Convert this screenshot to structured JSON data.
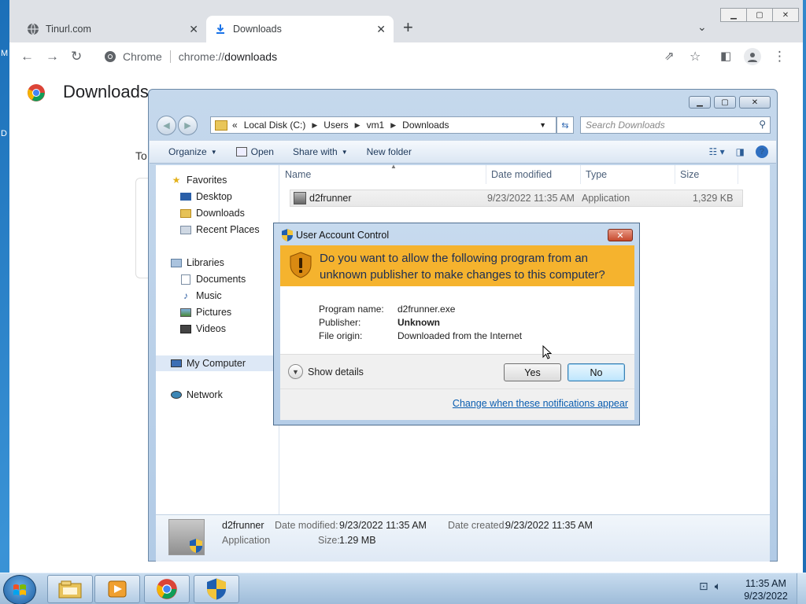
{
  "desktop": {
    "frag1": "M",
    "frag2": "D"
  },
  "chrome": {
    "tabs": [
      {
        "title": "Tinurl.com",
        "icon": "globe-icon"
      },
      {
        "title": "Downloads",
        "icon": "download-icon"
      }
    ],
    "omnibox": {
      "chip": "Chrome",
      "url_scheme": "chrome://",
      "url_path": "downloads"
    },
    "page": {
      "title": "Downloads",
      "frag": "To"
    }
  },
  "explorer": {
    "breadcrumb": [
      "Local Disk (C:)",
      "Users",
      "vm1",
      "Downloads"
    ],
    "search_placeholder": "Search Downloads",
    "commands": {
      "organize": "Organize",
      "open": "Open",
      "share_with": "Share with",
      "new_folder": "New folder"
    },
    "nav": {
      "favorites": "Favorites",
      "favorites_items": [
        "Desktop",
        "Downloads",
        "Recent Places"
      ],
      "libraries": "Libraries",
      "libraries_items": [
        "Documents",
        "Music",
        "Pictures",
        "Videos"
      ],
      "my_computer": "My Computer",
      "network": "Network"
    },
    "columns": [
      "Name",
      "Date modified",
      "Type",
      "Size"
    ],
    "files": [
      {
        "name": "d2frunner",
        "date": "9/23/2022 11:35 AM",
        "type": "Application",
        "size": "1,329 KB"
      }
    ],
    "details": {
      "name": "d2frunner",
      "type": "Application",
      "date_modified_label": "Date modified:",
      "date_modified": "9/23/2022 11:35 AM",
      "date_created_label": "Date created:",
      "date_created": "9/23/2022 11:35 AM",
      "size_label": "Size:",
      "size": "1.29 MB"
    }
  },
  "uac": {
    "title": "User Account Control",
    "question": "Do you want to allow the following program from an unknown publisher to make changes to this computer?",
    "program_name_label": "Program name:",
    "program_name": "d2frunner.exe",
    "publisher_label": "Publisher:",
    "publisher": "Unknown",
    "origin_label": "File origin:",
    "origin": "Downloaded from the Internet",
    "show_details": "Show details",
    "yes": "Yes",
    "no": "No",
    "link": "Change when these notifications appear"
  },
  "taskbar": {
    "time": "11:35 AM",
    "date": "9/23/2022",
    "apps": [
      "explorer-icon",
      "media-player-icon",
      "chrome-icon",
      "uac-shield-icon"
    ]
  },
  "colors": {
    "uac_banner": "#f5b32e",
    "link": "#0a5db0",
    "desktop": "#1b6fb8"
  }
}
